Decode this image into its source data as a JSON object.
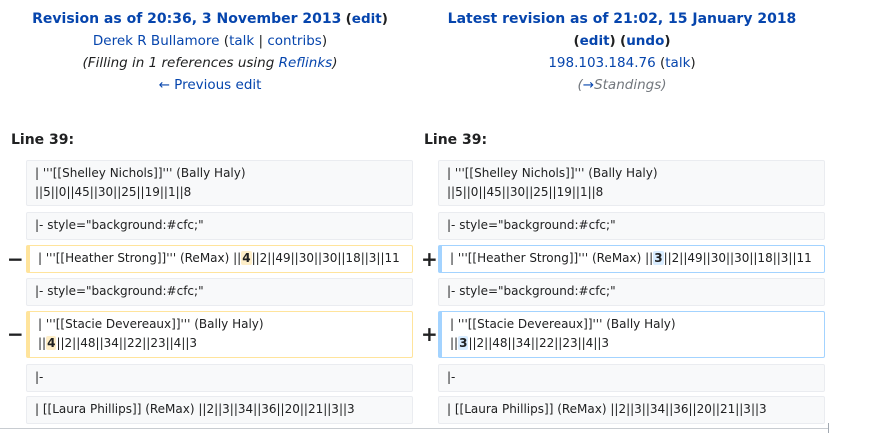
{
  "left_header": {
    "title": "Revision as of 20:36, 3 November 2013",
    "edit": "edit",
    "user": "Derek R Bullamore",
    "talk": "talk",
    "contribs": "contribs",
    "summary_prefix": "(Filling in 1 references using ",
    "summary_link": "Reflinks",
    "summary_suffix": ")",
    "prev_edit": "← Previous edit"
  },
  "right_header": {
    "title": "Latest revision as of 21:02, 15 January 2018",
    "edit": "edit",
    "undo": "undo",
    "user": "198.103.184.76",
    "talk": "talk",
    "section_prefix": "(",
    "section_arrow": "→",
    "section_name": "Standings",
    "section_suffix": ")"
  },
  "line_label": "Line 39:",
  "markers": {
    "minus": "−",
    "plus": "+"
  },
  "rows": {
    "r1": "| '''[[Shelley Nichols]]''' (Bally Haly)\n||5||0||45||30||25||19||1||8",
    "r2": "|- style=\"background:#cfc;\"",
    "r3_pre": "| '''[[Heather Strong]]''' (ReMax) ||",
    "r3_old": "4",
    "r3_new": "3",
    "r3_post": "||2||49||30||30||18||3||11",
    "r4": "|- style=\"background:#cfc;\"",
    "r5_pre": "| '''[[Stacie Devereaux]]''' (Bally Haly)\n||",
    "r5_old": "4",
    "r5_new": "3",
    "r5_post": "||2||48||34||22||23||4||3",
    "r6": "|-",
    "r7": "| [[Laura Phillips]] (ReMax) ||2||3||34||36||20||21||3||3"
  }
}
